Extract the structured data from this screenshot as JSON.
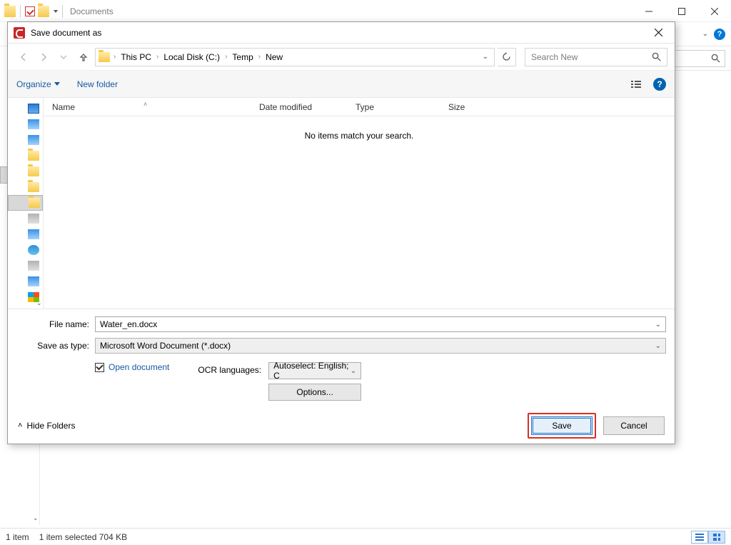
{
  "explorer": {
    "title": "Documents",
    "status_items": "1 item",
    "status_selected": "1 item selected  704 KB"
  },
  "dialog": {
    "title": "Save document as",
    "breadcrumb": {
      "p0": "This PC",
      "p1": "Local Disk (C:)",
      "p2": "Temp",
      "p3": "New"
    },
    "search_placeholder": "Search New",
    "organize": "Organize",
    "new_folder": "New folder",
    "columns": {
      "name": "Name",
      "date": "Date modified",
      "type": "Type",
      "size": "Size"
    },
    "empty_msg": "No items match your search.",
    "filename_label": "File name:",
    "filename_value": "Water_en.docx",
    "savetype_label": "Save as type:",
    "savetype_value": "Microsoft Word Document (*.docx)",
    "open_document": "Open document",
    "ocr_label": "OCR languages:",
    "ocr_value": "Autoselect: English; C",
    "options_btn": "Options...",
    "hide_folders": "Hide Folders",
    "save": "Save",
    "cancel": "Cancel"
  }
}
